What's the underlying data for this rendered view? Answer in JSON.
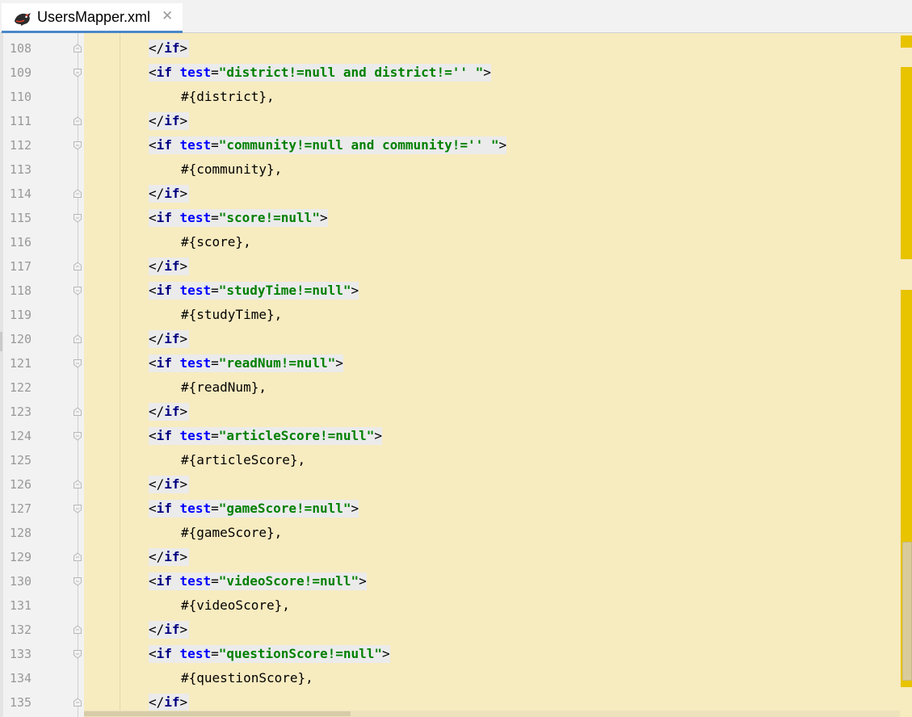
{
  "tab": {
    "title": "UsersMapper.xml",
    "icon": "mybatis-bird-icon",
    "close_label": "✕"
  },
  "colors": {
    "tag": "#000080",
    "attribute": "#0000ff",
    "string": "#008000",
    "code_background": "#f7ebc0",
    "marker": "#e8c300",
    "tab_underline": "#4a88c7"
  },
  "lines": [
    {
      "num": "108",
      "kind": "close",
      "text": "</if>"
    },
    {
      "num": "109",
      "kind": "open",
      "value": "\"district!=null and district!='' \""
    },
    {
      "num": "110",
      "kind": "body",
      "text": "#{district},"
    },
    {
      "num": "111",
      "kind": "close",
      "text": "</if>"
    },
    {
      "num": "112",
      "kind": "open",
      "value": "\"community!=null and community!='' \""
    },
    {
      "num": "113",
      "kind": "body",
      "text": "#{community},"
    },
    {
      "num": "114",
      "kind": "close",
      "text": "</if>"
    },
    {
      "num": "115",
      "kind": "open",
      "value": "\"score!=null\""
    },
    {
      "num": "116",
      "kind": "body",
      "text": "#{score},"
    },
    {
      "num": "117",
      "kind": "close",
      "text": "</if>"
    },
    {
      "num": "118",
      "kind": "open",
      "value": "\"studyTime!=null\""
    },
    {
      "num": "119",
      "kind": "body",
      "text": "#{studyTime},"
    },
    {
      "num": "120",
      "kind": "close",
      "text": "</if>"
    },
    {
      "num": "121",
      "kind": "open",
      "value": "\"readNum!=null\""
    },
    {
      "num": "122",
      "kind": "body",
      "text": "#{readNum},"
    },
    {
      "num": "123",
      "kind": "close",
      "text": "</if>"
    },
    {
      "num": "124",
      "kind": "open",
      "value": "\"articleScore!=null\""
    },
    {
      "num": "125",
      "kind": "body",
      "text": "#{articleScore},"
    },
    {
      "num": "126",
      "kind": "close",
      "text": "</if>"
    },
    {
      "num": "127",
      "kind": "open",
      "value": "\"gameScore!=null\""
    },
    {
      "num": "128",
      "kind": "body",
      "text": "#{gameScore},"
    },
    {
      "num": "129",
      "kind": "close",
      "text": "</if>"
    },
    {
      "num": "130",
      "kind": "open",
      "value": "\"videoScore!=null\""
    },
    {
      "num": "131",
      "kind": "body",
      "text": "#{videoScore},"
    },
    {
      "num": "132",
      "kind": "close",
      "text": "</if>"
    },
    {
      "num": "133",
      "kind": "open",
      "value": "\"questionScore!=null\""
    },
    {
      "num": "134",
      "kind": "body",
      "text": "#{questionScore},"
    },
    {
      "num": "135",
      "kind": "close",
      "text": "</if>"
    }
  ],
  "syntax": {
    "open_prefix": "<",
    "tag_name": "if",
    "attr_name": "test",
    "equals": "=",
    "open_suffix": ">"
  }
}
